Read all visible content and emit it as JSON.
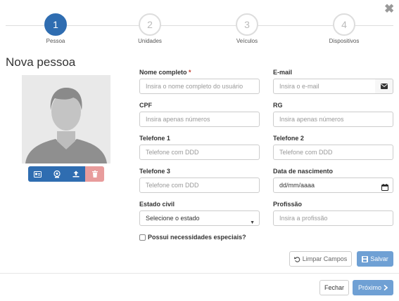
{
  "stepper": {
    "steps": [
      {
        "number": "1",
        "label": "Pessoa"
      },
      {
        "number": "2",
        "label": "Unidades"
      },
      {
        "number": "3",
        "label": "Veículos"
      },
      {
        "number": "4",
        "label": "Dispositivos"
      }
    ],
    "active_step": 1
  },
  "close_icon": "times-icon",
  "page_title": "Nova pessoa",
  "avatar_actions": [
    {
      "icon": "id-card-icon"
    },
    {
      "icon": "webcam-icon"
    },
    {
      "icon": "upload-icon"
    },
    {
      "icon": "trash-icon"
    }
  ],
  "form": {
    "full_name": {
      "label": "Nome completo",
      "required_mark": "*",
      "placeholder": "Insira o nome completo do usuário"
    },
    "email": {
      "label": "E-mail",
      "placeholder": "Insira o e-mail",
      "addon_icon": "envelope-icon"
    },
    "cpf": {
      "label": "CPF",
      "placeholder": "Insira apenas números"
    },
    "rg": {
      "label": "RG",
      "placeholder": "Insira apenas números"
    },
    "phone1": {
      "label": "Telefone 1",
      "placeholder": "Telefone com DDD"
    },
    "phone2": {
      "label": "Telefone 2",
      "placeholder": "Telefone com DDD"
    },
    "phone3": {
      "label": "Telefone 3",
      "placeholder": "Telefone com DDD"
    },
    "birth_date": {
      "label": "Data de nascimento",
      "value": "dd/mm/aaaa"
    },
    "civil_status": {
      "label": "Estado civil",
      "value": "Selecione o estado"
    },
    "profession": {
      "label": "Profissão",
      "placeholder": "Insira a profissão"
    },
    "special_needs": {
      "label": "Possui necessidades especiais?",
      "checked": false
    }
  },
  "actions": {
    "clear": "Limpar Campos",
    "save": "Salvar",
    "close": "Fechar",
    "next": "Próximo"
  },
  "colors": {
    "primary": "#2f6db1",
    "primary_light": "#6fa0d4",
    "danger_light": "#e89c9c"
  }
}
